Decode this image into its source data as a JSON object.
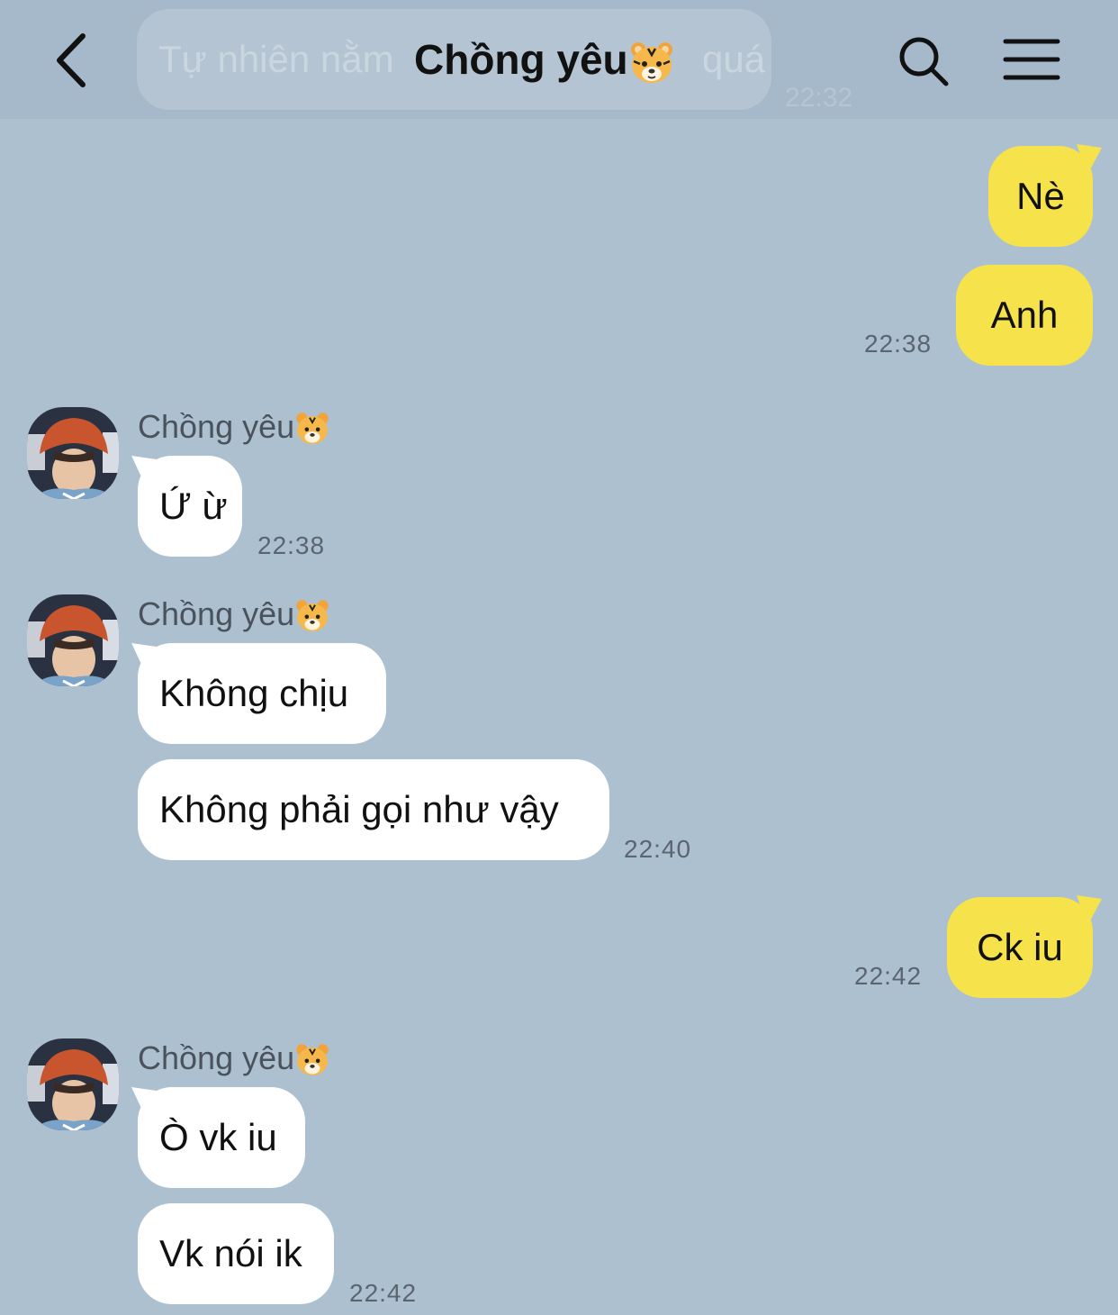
{
  "header": {
    "title": "Chồng yêu",
    "ghost_preview_text": "Tự nhiên nằm",
    "ghost_preview_tail": "quá",
    "ghost_preview_time": "22:32"
  },
  "icons": {
    "back": "chevron-left-icon",
    "search": "search-icon",
    "menu": "hamburger-menu-icon",
    "title_emoji": "tiger-face-emoji"
  },
  "colors": {
    "background": "#adc0d0",
    "my_bubble": "#f6e24b",
    "their_bubble": "#ffffff"
  },
  "messages": [
    {
      "from": "me",
      "text": "Nè"
    },
    {
      "from": "me",
      "text": "Anh",
      "time": "22:38"
    },
    {
      "from": "them",
      "sender": "Chồng yêu",
      "text": "Ứ ừ",
      "time": "22:38"
    },
    {
      "from": "them",
      "sender": "Chồng yêu",
      "text": "Không chịu"
    },
    {
      "from": "them",
      "text": "Không phải gọi như vậy",
      "time": "22:40"
    },
    {
      "from": "me",
      "text": "Ck iu",
      "time": "22:42"
    },
    {
      "from": "them",
      "sender": "Chồng yêu",
      "text": "Ò vk iu"
    },
    {
      "from": "them",
      "text": "Vk nói ik",
      "time": "22:42"
    }
  ]
}
